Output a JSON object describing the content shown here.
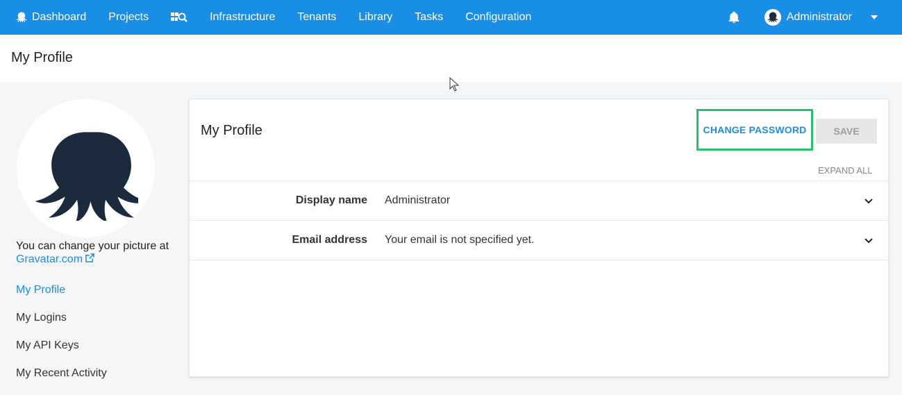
{
  "nav": {
    "items": [
      {
        "label": "Dashboard",
        "icon": "octopus-icon"
      },
      {
        "label": "Projects"
      },
      {
        "label": "",
        "icon": "search-grid-icon"
      },
      {
        "label": "Infrastructure"
      },
      {
        "label": "Tenants"
      },
      {
        "label": "Library"
      },
      {
        "label": "Tasks"
      },
      {
        "label": "Configuration"
      }
    ],
    "user_name": "Administrator",
    "accent_color": "#1a8ee6"
  },
  "page": {
    "title": "My Profile"
  },
  "sidebar": {
    "gravatar_text": "You can change your picture at ",
    "gravatar_link": "Gravatar.com",
    "links": [
      "My Profile",
      "My Logins",
      "My API Keys",
      "My Recent Activity"
    ],
    "active_index": 0
  },
  "card": {
    "title": "My Profile",
    "change_password_label": "CHANGE PASSWORD",
    "save_label": "SAVE",
    "expand_all_label": "EXPAND ALL",
    "rows": [
      {
        "label": "Display name",
        "value": "Administrator"
      },
      {
        "label": "Email address",
        "value": "Your email is not specified yet."
      }
    ],
    "highlight_color": "#28c06a"
  }
}
